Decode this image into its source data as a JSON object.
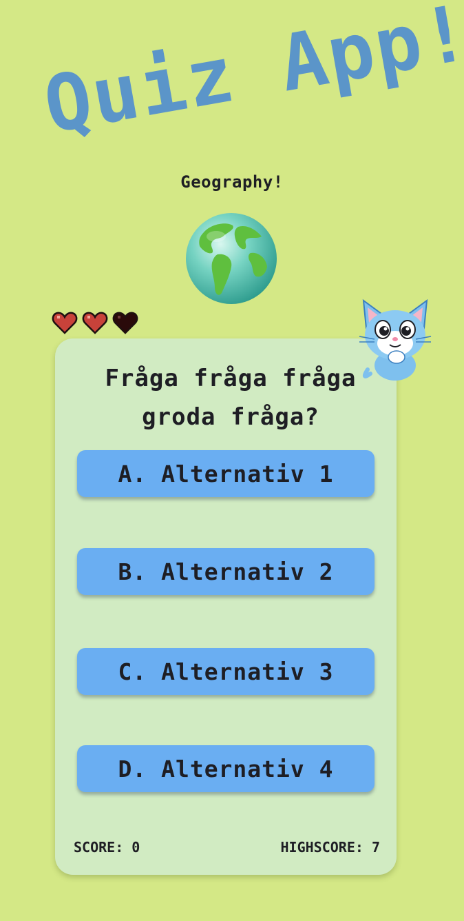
{
  "header": {
    "title": "Quiz App!",
    "category": "Geography!"
  },
  "lives": {
    "total": 3,
    "remaining": 2,
    "full_color": "#c8423a",
    "empty_color": "#2a0a0a"
  },
  "quiz": {
    "question": "Fråga fråga fråga groda fråga?",
    "answers": [
      {
        "label": "A. Alternativ 1"
      },
      {
        "label": "B. Alternativ 2"
      },
      {
        "label": "C. Alternativ 3"
      },
      {
        "label": "D. Alternativ 4"
      }
    ]
  },
  "footer": {
    "score": "SCORE: 0",
    "highscore": "HIGHSCORE: 7"
  },
  "colors": {
    "background": "#d4e886",
    "card": "#d1ebc2",
    "answer_button": "#6aaef2",
    "title": "#5b95c9"
  },
  "icons": {
    "globe": "globe-americas-icon",
    "mascot": "cat-mascot-icon",
    "life": "heart-icon"
  }
}
